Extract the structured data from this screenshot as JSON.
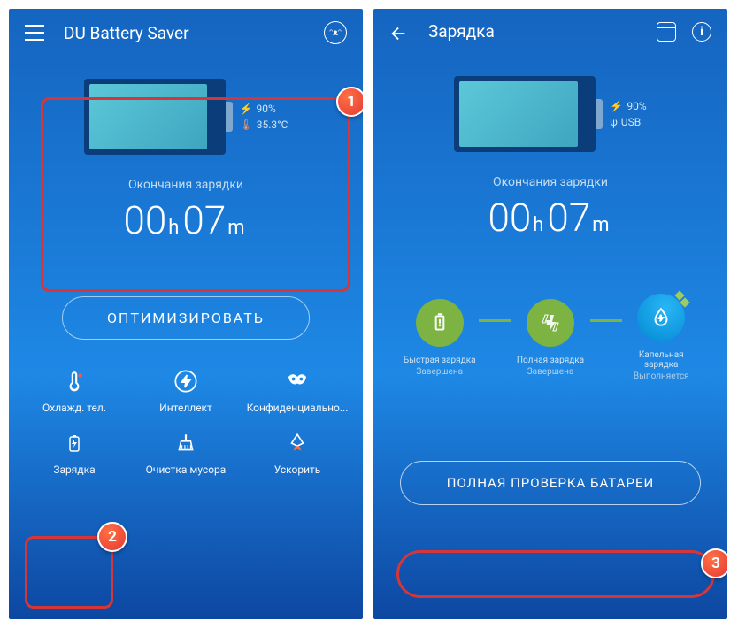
{
  "left": {
    "title": "DU Battery Saver",
    "battery_pct": "90%",
    "battery_temp": "35.3°C",
    "charge_label": "Окончания зарядки",
    "time_h": "00",
    "time_hu": "h",
    "time_m": "07",
    "time_mu": "m",
    "optimize": "ОПТИМИЗИРОВАТЬ",
    "grid": [
      {
        "label": "Охлажд. тел."
      },
      {
        "label": "Интеллект"
      },
      {
        "label": "Конфиденциально..."
      },
      {
        "label": "Зарядка"
      },
      {
        "label": "Очистка мусора"
      },
      {
        "label": "Ускорить"
      }
    ]
  },
  "right": {
    "title": "Зарядка",
    "battery_pct": "90%",
    "battery_src": "USB",
    "charge_label": "Окончания зарядки",
    "time_h": "00",
    "time_hu": "h",
    "time_m": "07",
    "time_mu": "m",
    "steps": [
      {
        "title": "Быстрая зарядка",
        "sub": "Завершена"
      },
      {
        "title": "Полная зарядка",
        "sub": "Завершена"
      },
      {
        "title": "Капельная зарядка",
        "sub": "Выполняется"
      }
    ],
    "full_check": "ПОЛНАЯ ПРОВЕРКА БАТАРЕИ"
  },
  "badges": {
    "b1": "1",
    "b2": "2",
    "b3": "3"
  }
}
